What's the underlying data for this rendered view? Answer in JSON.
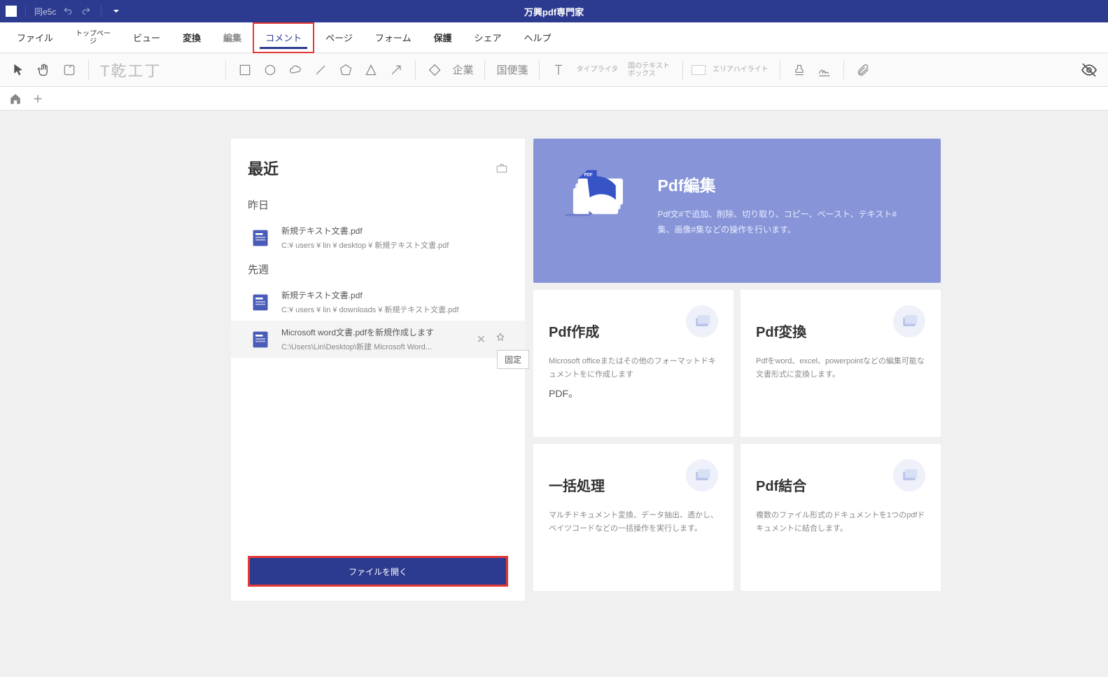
{
  "titlebar": {
    "doc_name": "同e5c",
    "app_title": "万興pdf専門家"
  },
  "menu": {
    "file": "ファイル",
    "top": "トップペー\nジ",
    "view": "ビュー",
    "convert": "変換",
    "edit": "編集",
    "comment": "コメント",
    "page": "ページ",
    "form": "フォーム",
    "protect": "保護",
    "share": "シェア",
    "help": "ヘルプ"
  },
  "toolbar": {
    "text_sample": "T乾工丁",
    "biz": "企業",
    "stationery": "国便箋",
    "typewriter": "タイプライタ",
    "textbox": "国のテキストボックス",
    "area_highlight": "エリアハイライト"
  },
  "recent": {
    "title": "最近",
    "yesterday": "昨日",
    "lastweek": "先週",
    "files": [
      {
        "name": "新規テキスト文書.pdf",
        "path": "C:¥ users ¥ lin ¥ desktop ¥ 新規テキスト文書.pdf"
      },
      {
        "name": "新規テキスト文書.pdf",
        "path": "C:¥ users ¥ lin ¥ downloads ¥ 新規テキスト文書.pdf"
      },
      {
        "name": "Microsoft word文書.pdfを新規作成します",
        "path": "C:\\Users\\Lin\\Desktop\\新建 Microsoft Word..."
      }
    ],
    "pin_tooltip": "固定",
    "open_file": "ファイルを開く"
  },
  "feature": {
    "title": "Pdf編集",
    "desc": "Pdf文#で追加、削除、切り取り、コピー、ペースト、テキスト#集、画像#集などの操作を行います。"
  },
  "cards": {
    "create": {
      "title": "Pdf作成",
      "desc": "Microsoft officeまたはその他のフォーマットドキュメントをに作成します",
      "desc2": "PDF。"
    },
    "convert": {
      "title": "Pdf変換",
      "desc": "Pdfをword、excel、powerpointなどの編集可能な文書形式に変換します。"
    },
    "batch": {
      "title": "一括処理",
      "desc": "マルチドキュメント変換、データ抽出、透かし、ベイツコードなどの一括操作を実行します。"
    },
    "merge": {
      "title": "Pdf結合",
      "desc": "複数のファイル形式のドキュメントを1つのpdfドキュメントに結合します。"
    }
  }
}
